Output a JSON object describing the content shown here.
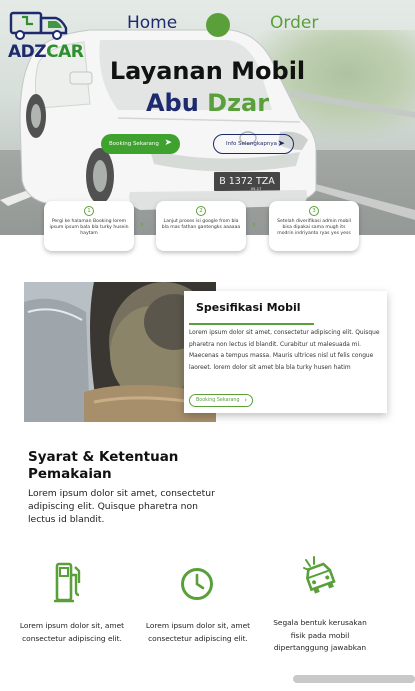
{
  "brand": {
    "logo_adz": "ADZ",
    "logo_car": "CAR"
  },
  "nav": {
    "home_label": "Home",
    "order_label": "Order"
  },
  "hero": {
    "title_line1": "Layanan Mobil",
    "title_abu": "Abu",
    "title_dzar": "Dzar",
    "booking_label": "Booking Sekarang",
    "secondary_label": "Info Selengkapnya",
    "plate": "B 1372 TZA",
    "plate_small": "05.17"
  },
  "steps": [
    {
      "num": "1",
      "text": "Pergi ke halaman Booking lorem ipsum ipsum bala bla turky husein haytam"
    },
    {
      "num": "2",
      "text": "Lanjut proses isi google from bla bla mas fathan gantengks aaaaaa"
    },
    {
      "num": "3",
      "text": "Setelah diverifikasi admin mobil bisa dipakai sama mugh its modrin indriyanto ryas yes yess"
    }
  ],
  "spec": {
    "title": "Spesifikasi Mobil",
    "body": "Lorem ipsum dolor sit amet, consectetur adipiscing elit. Quisque pharetra non lectus id blandit. Curabitur ut malesuada mi. Maecenas a tempus massa. Mauris ultrices nisl ut felis congue laoreet. lorem dolor sit amet bla bla turky  husen hatim",
    "button_label": "Booking Sekarang"
  },
  "terms": {
    "title": "Syarat & Ketentuan Pemakaian",
    "body": "Lorem ipsum dolor sit amet, consectetur adipiscing elit. Quisque pharetra non lectus id blandit."
  },
  "features": [
    {
      "icon": "gas-pump-icon",
      "text": "Lorem ipsum dolor sit, amet consectetur adipiscing elit."
    },
    {
      "icon": "clock-icon",
      "text": "Lorem ipsum dolor sit, amet consectetur adipiscing elit."
    },
    {
      "icon": "car-crash-icon",
      "text": "Segala bentuk kerusakan fisik pada mobil dipertanggung jawabkan"
    }
  ],
  "colors": {
    "navy": "#1d2a6e",
    "green": "#5aa03a",
    "button_green": "#3fa12e"
  }
}
